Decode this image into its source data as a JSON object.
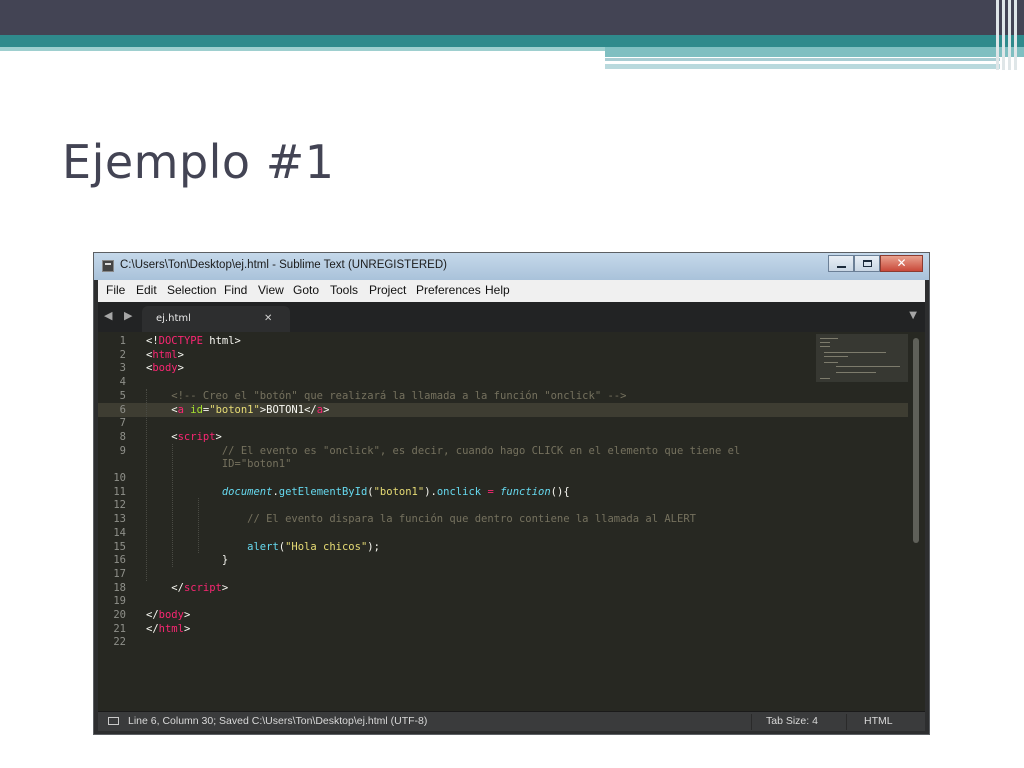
{
  "slide": {
    "title": "Ejemplo #1"
  },
  "window": {
    "title": "C:\\Users\\Ton\\Desktop\\ej.html - Sublime Text (UNREGISTERED)",
    "close_glyph": "✕"
  },
  "menu": [
    "File",
    "Edit",
    "Selection",
    "Find",
    "View",
    "Goto",
    "Tools",
    "Project",
    "Preferences",
    "Help"
  ],
  "tabs": {
    "nav_arrows": "◀ ▶",
    "active_tab": "ej.html",
    "close_glyph": "✕",
    "dropdown_glyph": "▼"
  },
  "editor": {
    "active_line": 6,
    "line_numbers": [
      "1",
      "2",
      "3",
      "4",
      "5",
      "6",
      "7",
      "8",
      "9",
      "",
      "10",
      "11",
      "12",
      "13",
      "14",
      "15",
      "16",
      "17",
      "18",
      "19",
      "20",
      "21",
      "22"
    ],
    "lines": [
      [
        [
          "<!",
          "c-punc"
        ],
        [
          "DOCTYPE",
          "c-doc"
        ],
        [
          " html>",
          "c-punc"
        ]
      ],
      [
        [
          "<",
          "c-punc"
        ],
        [
          "html",
          "c-tag"
        ],
        [
          ">",
          "c-punc"
        ]
      ],
      [
        [
          "<",
          "c-punc"
        ],
        [
          "body",
          "c-tag"
        ],
        [
          ">",
          "c-punc"
        ]
      ],
      [],
      [
        [
          "    <!-- Creo el \"botón\" que realizará la llamada a la función \"onclick\" -->",
          "c-cmt"
        ]
      ],
      [
        [
          "    <",
          "c-punc"
        ],
        [
          "a",
          "c-tag"
        ],
        [
          " ",
          "c-punc"
        ],
        [
          "id",
          "c-attr"
        ],
        [
          "=",
          "c-punc"
        ],
        [
          "\"boton1\"",
          "c-str"
        ],
        [
          ">BOTON1</",
          "c-punc"
        ],
        [
          "a",
          "c-tag"
        ],
        [
          ">",
          "c-punc"
        ]
      ],
      [],
      [
        [
          "    <",
          "c-punc"
        ],
        [
          "script",
          "c-tag"
        ],
        [
          ">",
          "c-punc"
        ]
      ],
      [
        [
          "            // El evento es \"onclick\", es decir, cuando hago CLICK en el elemento que tiene el",
          "c-cmt"
        ]
      ],
      [
        [
          "            ID=\"boton1\"",
          "c-cmt"
        ]
      ],
      [],
      [
        [
          "            ",
          "c-punc"
        ],
        [
          "document",
          "c-obj"
        ],
        [
          ".",
          "c-punc"
        ],
        [
          "getElementById",
          "c-fn"
        ],
        [
          "(",
          "c-punc"
        ],
        [
          "\"boton1\"",
          "c-str"
        ],
        [
          ").",
          "c-punc"
        ],
        [
          "onclick",
          "c-fn"
        ],
        [
          " ",
          "c-punc"
        ],
        [
          "=",
          "c-op"
        ],
        [
          " ",
          "c-punc"
        ],
        [
          "function",
          "c-kw"
        ],
        [
          "(){",
          "c-punc"
        ]
      ],
      [],
      [
        [
          "                // El evento dispara la función que dentro contiene la llamada al ALERT",
          "c-cmt"
        ]
      ],
      [],
      [
        [
          "                ",
          "c-punc"
        ],
        [
          "alert",
          "c-fn"
        ],
        [
          "(",
          "c-punc"
        ],
        [
          "\"Hola chicos\"",
          "c-str"
        ],
        [
          ");",
          "c-punc"
        ]
      ],
      [
        [
          "            }",
          "c-punc"
        ]
      ],
      [],
      [
        [
          "    </",
          "c-punc"
        ],
        [
          "script",
          "c-tag"
        ],
        [
          ">",
          "c-punc"
        ]
      ],
      [],
      [
        [
          "</",
          "c-punc"
        ],
        [
          "body",
          "c-tag"
        ],
        [
          ">",
          "c-punc"
        ]
      ],
      [
        [
          "</",
          "c-punc"
        ],
        [
          "html",
          "c-tag"
        ],
        [
          ">",
          "c-punc"
        ]
      ],
      []
    ]
  },
  "status": {
    "position": "Line 6, Column 30; Saved C:\\Users\\Ton\\Desktop\\ej.html (UTF-8)",
    "tab_size": "Tab Size: 4",
    "syntax": "HTML"
  },
  "colors": {
    "slide_dark": "#434454",
    "slide_teal": "#2f8a8c",
    "editor_bg": "#272822",
    "tag": "#f92672",
    "string": "#e6db74",
    "comment": "#75715e"
  }
}
